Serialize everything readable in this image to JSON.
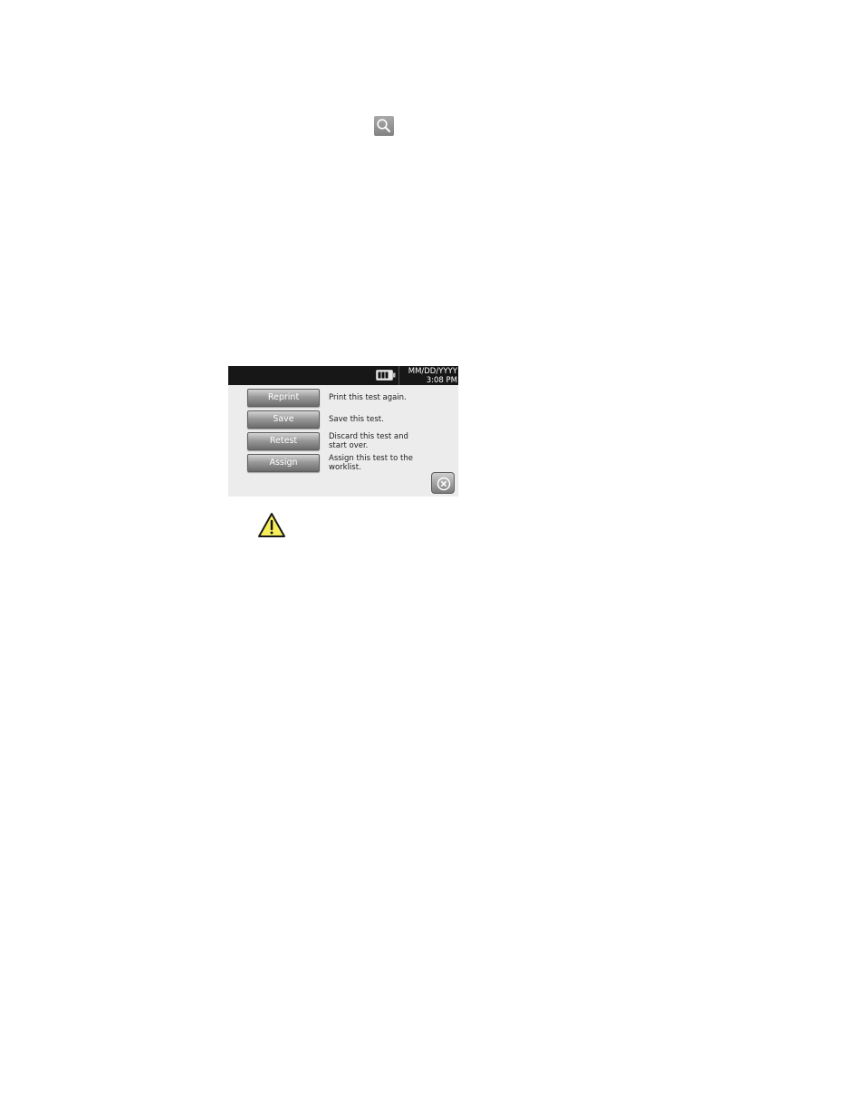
{
  "status_bar": {
    "date": "MM/DD/YYYY",
    "time": "3:08 PM",
    "battery_icon": "battery-icon"
  },
  "menu": {
    "items": [
      {
        "label": "Reprint",
        "description": "Print this test again."
      },
      {
        "label": "Save",
        "description": "Save this test."
      },
      {
        "label": "Retest",
        "description": "Discard this test and start over."
      },
      {
        "label": "Assign",
        "description": "Assign this test to the worklist."
      }
    ]
  },
  "icons": {
    "zoom": "magnifier-icon",
    "close": "close-circle-icon",
    "warning": "warning-triangle-icon"
  },
  "colors": {
    "status_bar_bg": "#171717",
    "screen_bg": "#ececec",
    "warning_fill": "#f7ef5a"
  }
}
